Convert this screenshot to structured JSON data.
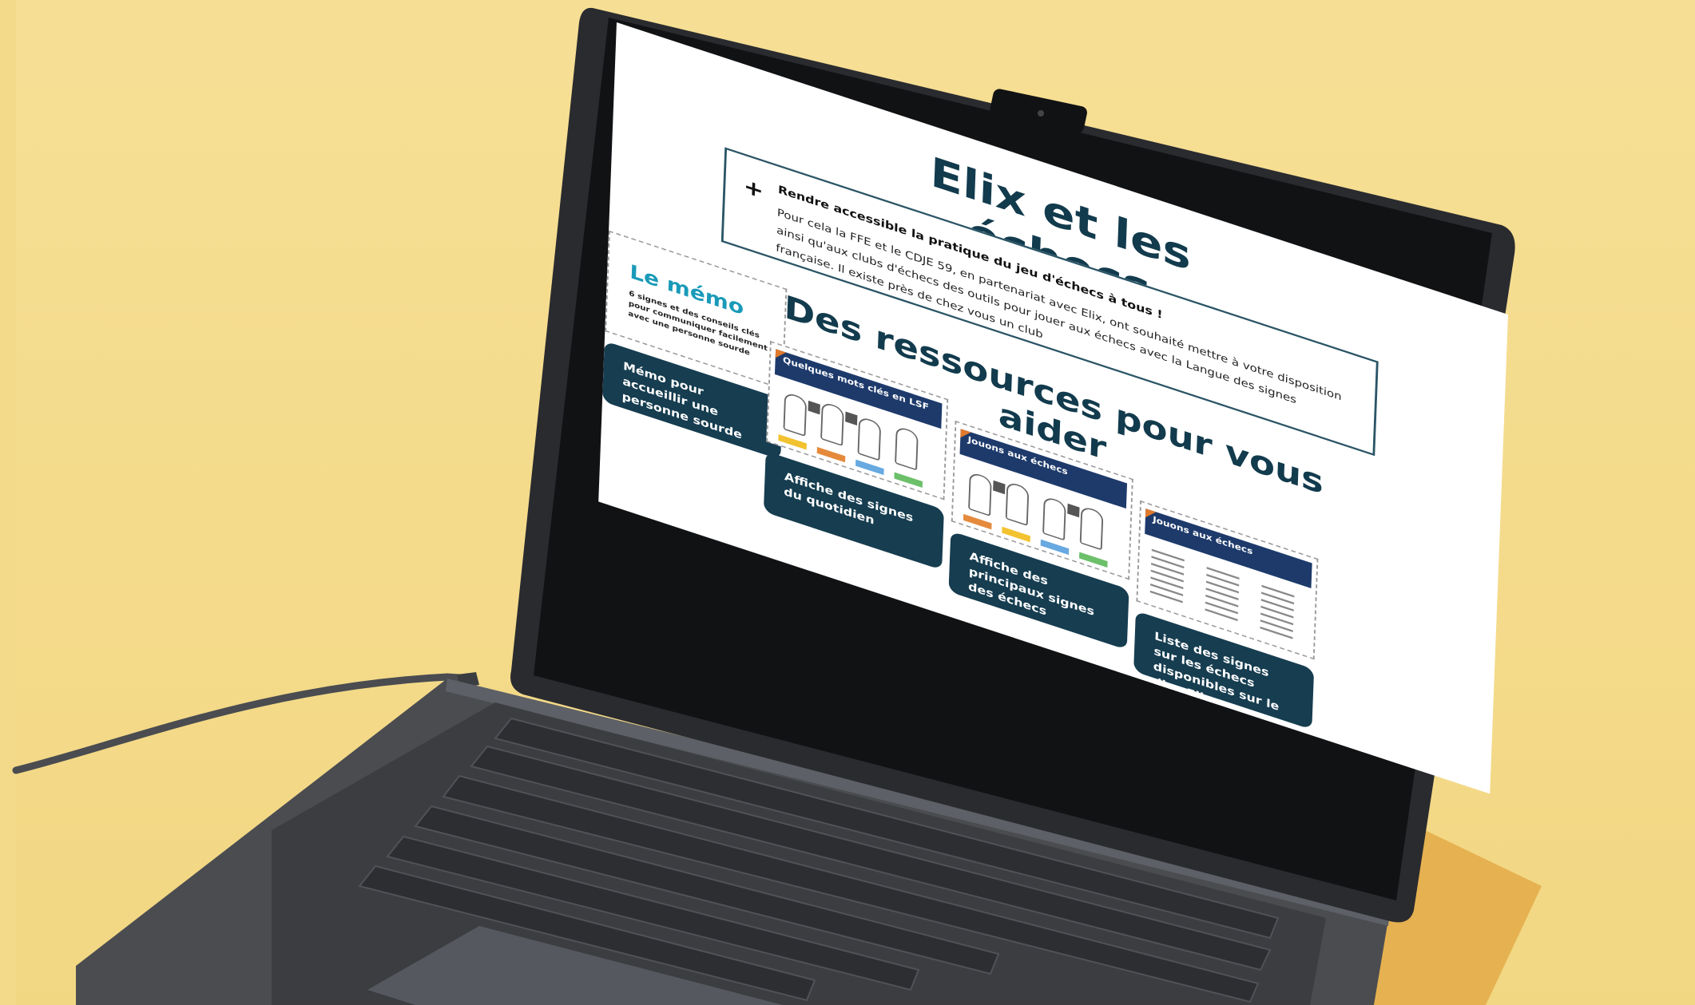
{
  "colors": {
    "background": "#f3d98a",
    "laptop_body": "#3d3f43",
    "screen_bezel": "#1c1d20",
    "title_text": "#123b4d",
    "button_bg": "#163d50",
    "memo_accent": "#1a9ab8"
  },
  "page": {
    "title": "Elix et les échecs",
    "accordion": {
      "icon": "plus-icon",
      "heading": "Rendre accessible la pratique du jeu d'échecs à tous !",
      "text": "Pour cela la FFE et le CDJE 59, en partenariat avec Elix, ont souhaité mettre à votre disposition ainsi qu'aux clubs d'échecs des outils pour jouer aux échecs avec la Langue des signes française. Il existe près de chez vous un club"
    },
    "section_title": "Des ressources pour vous aider",
    "resources": [
      {
        "thumb_title": "Le mémo",
        "thumb_sub": "6 signes et des conseils clés pour communiquer facilement avec une personne sourde",
        "button": "Mémo pour accueillir une personne sourde"
      },
      {
        "thumb_title": "Quelques mots clés en LSF",
        "button": "Affiche des signes du quotidien"
      },
      {
        "thumb_title": "Jouons aux échecs",
        "button": "Affiche des principaux signes des échecs"
      },
      {
        "thumb_title": "Jouons aux échecs",
        "button": "Liste des signes sur les échecs disponibles sur le dico Elix"
      }
    ]
  }
}
